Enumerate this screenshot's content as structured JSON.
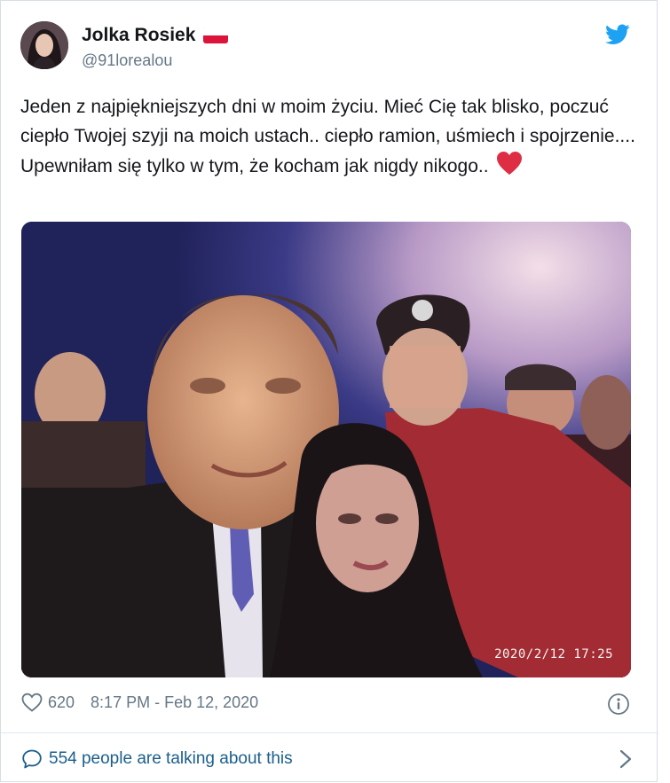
{
  "tweet": {
    "author": {
      "display_name": "Jolka Rosiek",
      "handle": "@91lorealou",
      "flag": "poland-flag"
    },
    "text": "Jeden z najpiękniejszych dni w moim życiu. Mieć Cię tak blisko, poczuć ciepło Twojej szyji na moich ustach.. ciepło ramion, uśmiech i spojrzenie.... Upewniłam się tylko w tym, że kocham jak nigdy nikogo..",
    "emoji": "red-heart",
    "photo": {
      "timestamp_overlay": "2020/2/12  17:25"
    },
    "likes": "620",
    "posted_at": "8:17 PM - Feb 12, 2020",
    "conversation": "554 people are talking about this"
  },
  "colors": {
    "twitter_blue": "#1da1f2",
    "link_blue": "#1b5e8c",
    "secondary_text": "#657786",
    "heart_red": "#e0245e"
  }
}
